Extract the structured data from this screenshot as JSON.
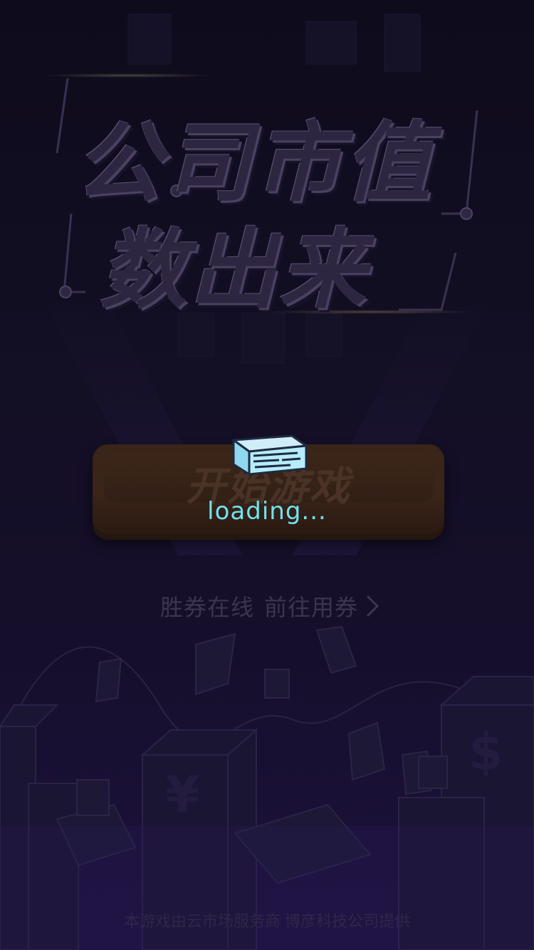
{
  "title": {
    "line1": "公司市值",
    "line2": "数出来"
  },
  "start_button": {
    "label": "开始游戏"
  },
  "loading": {
    "text": "loading...",
    "icon": "cash-box-icon"
  },
  "coupon": {
    "text1": "胜券在线",
    "text2": "前往用券",
    "icon": "chevron-right-icon"
  },
  "footer": {
    "text": "本游戏由云市场服务商 博彦科技公司提供"
  },
  "colors": {
    "loading_text": "#6fe2ee",
    "background_top": "#0e0b1c",
    "background_bottom": "#1d1240",
    "button": "#3a2518"
  }
}
